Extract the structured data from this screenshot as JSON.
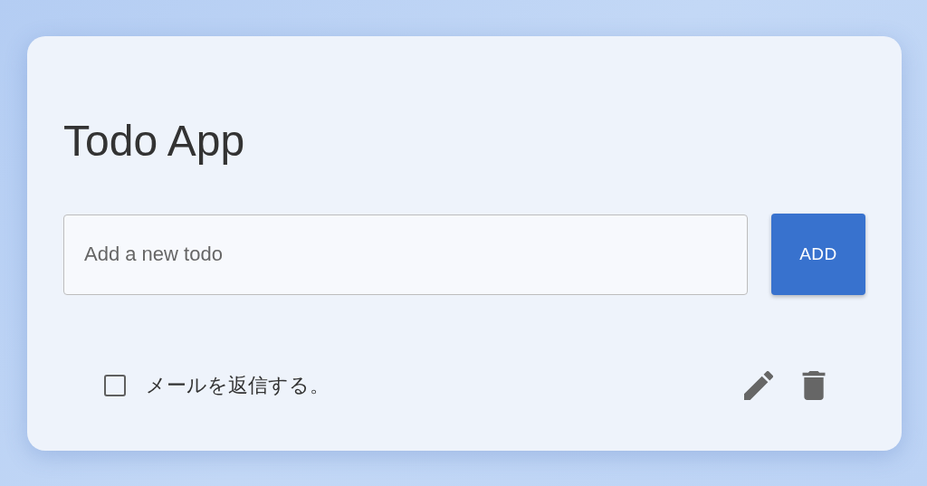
{
  "title": "Todo App",
  "new_todo": {
    "placeholder": "Add a new todo"
  },
  "add_button": "ADD",
  "todos": [
    {
      "text": "メールを返信する。",
      "checked": false
    }
  ]
}
